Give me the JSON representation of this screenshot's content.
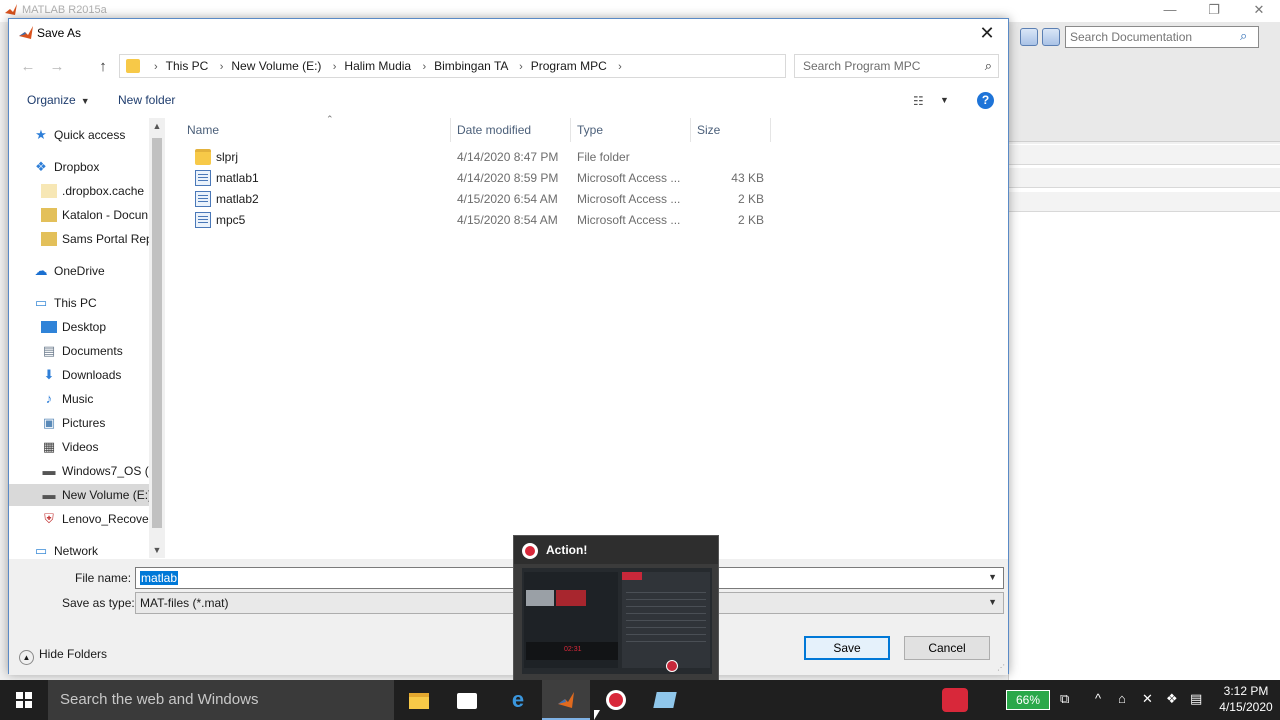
{
  "matlab": {
    "window_title": "MATLAB R2015a",
    "doc_search_placeholder": "Search Documentation"
  },
  "dialog": {
    "title": "Save As",
    "close_glyph": "✕",
    "breadcrumbs": [
      "This PC",
      "New Volume (E:)",
      "Halim Mudia",
      "Bimbingan TA",
      "Program MPC"
    ],
    "search_placeholder": "Search Program MPC",
    "organize_label": "Organize",
    "new_folder_label": "New folder"
  },
  "nav": {
    "items": [
      {
        "label": "Quick access",
        "icon": "star-icon"
      },
      {
        "label": "Dropbox",
        "icon": "dropbox-icon"
      },
      {
        "label": ".dropbox.cache",
        "icon": "folder-icon"
      },
      {
        "label": "Katalon - Docun",
        "icon": "folder-image-icon"
      },
      {
        "label": "Sams Portal Rep",
        "icon": "folder-image-icon"
      },
      {
        "label": "OneDrive",
        "icon": "cloud-icon"
      },
      {
        "label": "This PC",
        "icon": "computer-icon"
      },
      {
        "label": "Desktop",
        "icon": "desktop-icon"
      },
      {
        "label": "Documents",
        "icon": "documents-icon"
      },
      {
        "label": "Downloads",
        "icon": "download-icon"
      },
      {
        "label": "Music",
        "icon": "music-icon"
      },
      {
        "label": "Pictures",
        "icon": "pictures-icon"
      },
      {
        "label": "Videos",
        "icon": "videos-icon"
      },
      {
        "label": "Windows7_OS (C",
        "icon": "drive-icon"
      },
      {
        "label": "New Volume (E:)",
        "icon": "drive-icon"
      },
      {
        "label": "Lenovo_Recover",
        "icon": "recovery-drive-icon"
      },
      {
        "label": "Network",
        "icon": "network-icon"
      }
    ]
  },
  "files": {
    "columns": [
      "Name",
      "Date modified",
      "Type",
      "Size"
    ],
    "rows": [
      {
        "name": "slprj",
        "date": "4/14/2020 8:47 PM",
        "type": "File folder",
        "size": "",
        "icon": "folder-icon"
      },
      {
        "name": "matlab1",
        "date": "4/14/2020 8:59 PM",
        "type": "Microsoft Access ...",
        "size": "43 KB",
        "icon": "access-file-icon"
      },
      {
        "name": "matlab2",
        "date": "4/15/2020 6:54 AM",
        "type": "Microsoft Access ...",
        "size": "2 KB",
        "icon": "access-file-icon"
      },
      {
        "name": "mpc5",
        "date": "4/15/2020 8:54 AM",
        "type": "Microsoft Access ...",
        "size": "2 KB",
        "icon": "access-file-icon"
      }
    ]
  },
  "form": {
    "file_name_label": "File name:",
    "file_name_value": "matlab",
    "save_type_label": "Save as type:",
    "save_type_value": "MAT-files (*.mat)",
    "hide_folders_label": "Hide Folders",
    "save_label": "Save",
    "cancel_label": "Cancel"
  },
  "action_overlay": {
    "title": "Action!",
    "timer": "02:31"
  },
  "taskbar": {
    "search_placeholder": "Search the web and Windows",
    "battery": "66%",
    "time": "3:12 PM",
    "date": "4/15/2020"
  },
  "colors": {
    "accent": "#0078d7",
    "record_red": "#d8283a",
    "taskbar_bg": "#1f1f1f"
  }
}
